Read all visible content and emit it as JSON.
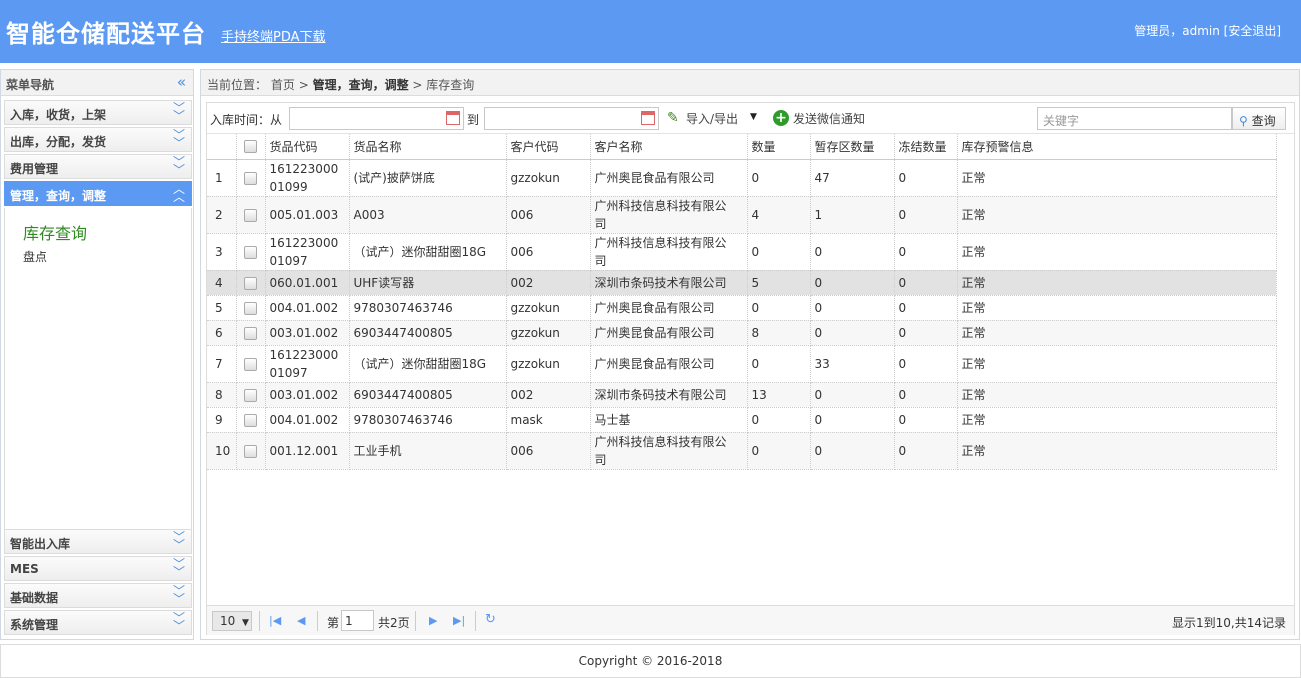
{
  "header": {
    "title": "智能仓储配送平台",
    "pda_link": "手持终端PDA下载",
    "user_text": "管理员，admin [安全退出]"
  },
  "sidebar": {
    "title": "菜单导航",
    "collapse_icon": "«",
    "groups": [
      {
        "label": "入库，收货，上架"
      },
      {
        "label": "出库，分配，发货"
      },
      {
        "label": "费用管理"
      },
      {
        "label": "管理，查询，调整"
      },
      {
        "label": "智能出入库"
      },
      {
        "label": "MES"
      },
      {
        "label": "基础数据"
      },
      {
        "label": "系统管理"
      }
    ],
    "active_items": [
      "库存查询",
      "盘点"
    ]
  },
  "breadcrumb": {
    "prefix": "当前位置：",
    "home": "首页",
    "section": "管理，查询，调整",
    "page": "库存查询"
  },
  "toolbar": {
    "date_label": "入库时间：从",
    "to_label": "到",
    "import_export": "导入/导出",
    "wechat": "发送微信通知",
    "keyword_placeholder": "关键字",
    "search_label": "查询"
  },
  "table": {
    "columns": [
      "货品代码",
      "货品名称",
      "客户代码",
      "客户名称",
      "数量",
      "暂存区数量",
      "冻结数量",
      "库存预警信息"
    ],
    "rows": [
      [
        "1",
        "161223000\n01099",
        "(试产)披萨饼底",
        "gzzokun",
        "广州奥昆食品有限公司",
        "0",
        "47",
        "0",
        "正常"
      ],
      [
        "2",
        "005.01.003",
        "A003",
        "006",
        "广州科技信息科技有限公\n司",
        "4",
        "1",
        "0",
        "正常"
      ],
      [
        "3",
        "161223000\n01097",
        "（试产）迷你甜甜圈18G",
        "006",
        "广州科技信息科技有限公\n司",
        "0",
        "0",
        "0",
        "正常"
      ],
      [
        "4",
        "060.01.001",
        "UHF读写器",
        "002",
        "深圳市条码技术有限公司",
        "5",
        "0",
        "0",
        "正常"
      ],
      [
        "5",
        "004.01.002",
        "9780307463746",
        "gzzokun",
        "广州奥昆食品有限公司",
        "0",
        "0",
        "0",
        "正常"
      ],
      [
        "6",
        "003.01.002",
        "6903447400805",
        "gzzokun",
        "广州奥昆食品有限公司",
        "8",
        "0",
        "0",
        "正常"
      ],
      [
        "7",
        "161223000\n01097",
        "（试产）迷你甜甜圈18G",
        "gzzokun",
        "广州奥昆食品有限公司",
        "0",
        "33",
        "0",
        "正常"
      ],
      [
        "8",
        "003.01.002",
        "6903447400805",
        "002",
        "深圳市条码技术有限公司",
        "13",
        "0",
        "0",
        "正常"
      ],
      [
        "9",
        "004.01.002",
        "9780307463746",
        "mask",
        "马士基",
        "0",
        "0",
        "0",
        "正常"
      ],
      [
        "10",
        "001.12.001",
        "工业手机",
        "006",
        "广州科技信息科技有限公\n司",
        "0",
        "0",
        "0",
        "正常"
      ]
    ]
  },
  "pager": {
    "page_size": "10",
    "page_prefix": "第",
    "page_value": "1",
    "page_total": "共2页",
    "info": "显示1到10,共14记录"
  },
  "footer": {
    "copyright": "Copyright © 2016-2018"
  }
}
